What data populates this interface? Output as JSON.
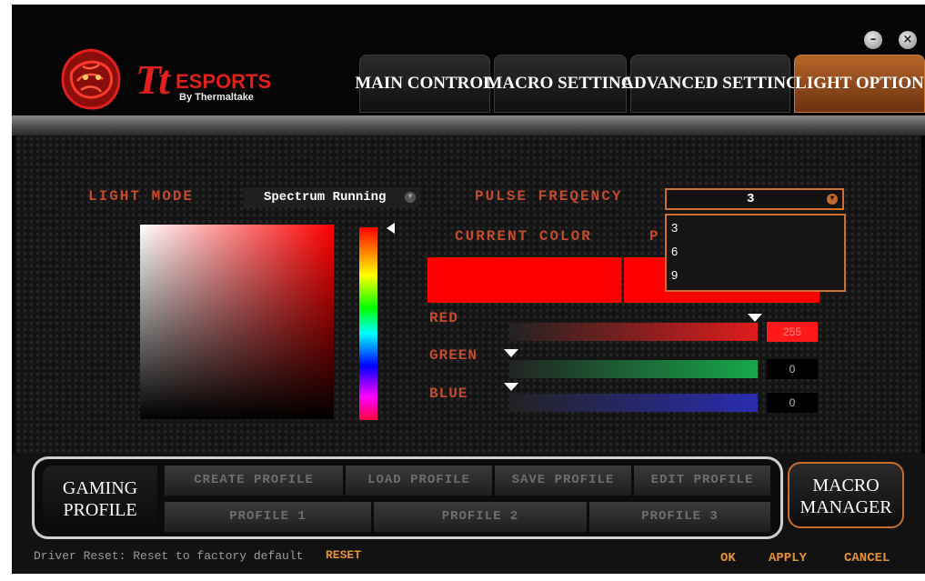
{
  "brand": {
    "logo_main": "Tt",
    "logo_sub": "ESPORTS",
    "logo_tagline": "By Thermaltake"
  },
  "window_controls": {
    "minimize_icon": "minimize-icon",
    "close_icon": "close-icon"
  },
  "tabs": [
    {
      "label": "MAIN CONTROL",
      "active": false
    },
    {
      "label": "MACRO SETTING",
      "active": false
    },
    {
      "label": "ADVANCED SETTING",
      "active": false
    },
    {
      "label": "LIGHT OPTION",
      "active": true
    }
  ],
  "light": {
    "mode_label": "LIGHT MODE",
    "mode_value": "Spectrum Running",
    "frequency_label": "PULSE FREQENCY",
    "frequency_value": "3",
    "frequency_options": [
      "3",
      "6",
      "9"
    ],
    "current_color_label": "CURRENT COLOR",
    "previous_color_label_partial": "P",
    "current_color_hex": "#ff0000"
  },
  "rgb": {
    "red_label": "RED",
    "red_value": "255",
    "green_label": "GREEN",
    "green_value": "0",
    "blue_label": "BLUE",
    "blue_value": "0"
  },
  "profiles": {
    "gaming_profile_line1": "GAMING",
    "gaming_profile_line2": "PROFILE",
    "create": "CREATE PROFILE",
    "load": "LOAD PROFILE",
    "save": "SAVE PROFILE",
    "edit": "EDIT PROFILE",
    "profile1": "PROFILE 1",
    "profile2": "PROFILE 2",
    "profile3": "PROFILE 3",
    "macro_manager_line1": "MACRO",
    "macro_manager_line2": "MANAGER"
  },
  "footer": {
    "reset_text": "Driver Reset: Reset to factory default",
    "reset_link": "RESET",
    "ok": "OK",
    "apply": "APPLY",
    "cancel": "CANCEL"
  },
  "colors": {
    "accent": "#c86d2a",
    "label": "#c44b2b",
    "link": "#e59030"
  }
}
